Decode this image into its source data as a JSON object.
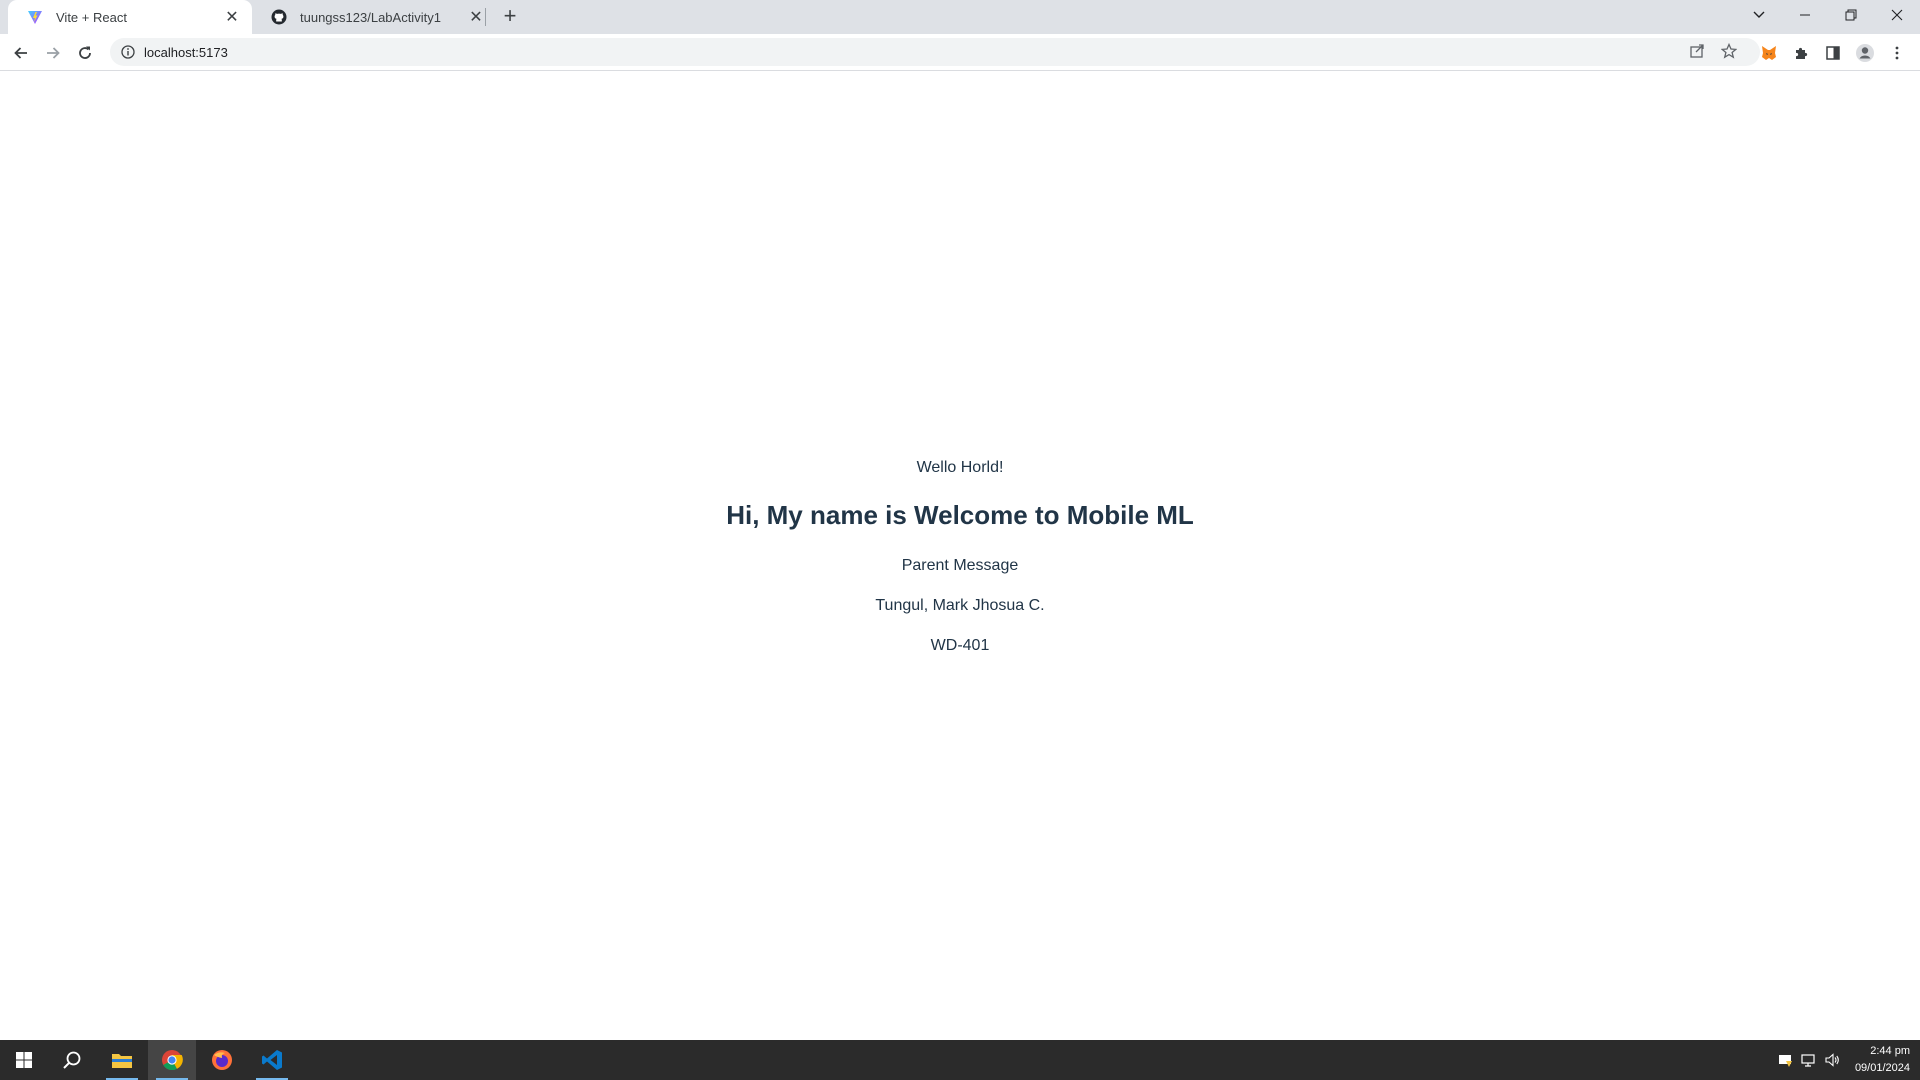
{
  "browser": {
    "tabs": [
      {
        "title": "Vite + React",
        "icon": "vite-logo-icon"
      },
      {
        "title": "tuungss123/LabActivity1",
        "icon": "github-icon"
      }
    ],
    "url": "localhost:5173"
  },
  "page": {
    "greeting": "Wello Horld!",
    "heading": "Hi, My name is Welcome to Mobile ML",
    "parent_message": "Parent Message",
    "name": "Tungul, Mark Jhosua C.",
    "section": "WD-401"
  },
  "taskbar": {
    "apps": [
      "windows-start-icon",
      "search-icon",
      "file-explorer-icon",
      "chrome-icon",
      "firefox-icon",
      "vscode-icon"
    ],
    "time": "2:44 pm",
    "date": "09/01/2024"
  },
  "colors": {
    "text": "#213547",
    "tabstrip": "#dee1e6",
    "taskbar": "#2b2b2b"
  }
}
